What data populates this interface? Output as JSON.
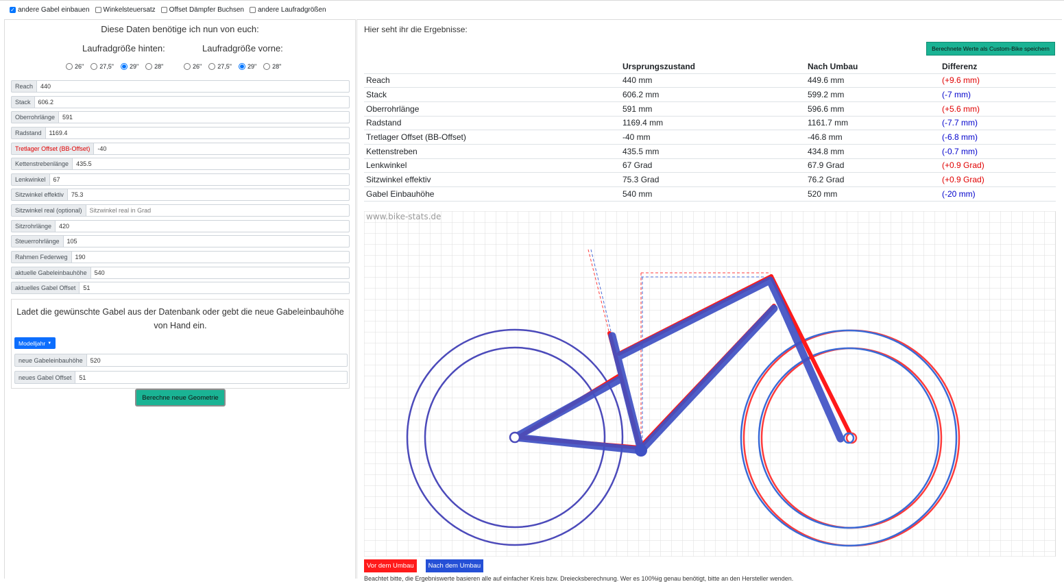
{
  "options": [
    {
      "label": "andere Gabel einbauen",
      "checked": true
    },
    {
      "label": "Winkelsteuersatz",
      "checked": false
    },
    {
      "label": "Offset Dämpfer Buchsen",
      "checked": false
    },
    {
      "label": "andere Laufradgrößen",
      "checked": false
    }
  ],
  "left": {
    "title": "Diese Daten benötige ich nun von euch:",
    "rear_label": "Laufradgröße hinten:",
    "front_label": "Laufradgröße vorne:",
    "rear_sizes": [
      "26\"",
      "27,5\"",
      "29\"",
      "28\""
    ],
    "front_sizes": [
      "26\"",
      "27,5\"",
      "29\"",
      "28\""
    ],
    "rear_selected": "29\"",
    "front_selected": "29\"",
    "fields": [
      {
        "label": "Reach",
        "value": "440"
      },
      {
        "label": "Stack",
        "value": "606.2"
      },
      {
        "label": "Oberrohrlänge",
        "value": "591"
      },
      {
        "label": "Radstand",
        "value": "1169.4"
      },
      {
        "label": "Tretlager Offset (BB-Offset)",
        "value": "-40",
        "highlight": true
      },
      {
        "label": "Kettenstrebenlänge",
        "value": "435.5"
      },
      {
        "label": "Lenkwinkel",
        "value": "67"
      },
      {
        "label": "Sitzwinkel effektiv",
        "value": "75.3"
      },
      {
        "label": "Sitzwinkel real (optional)",
        "value": "",
        "placeholder": "Sitzwinkel real in Grad"
      },
      {
        "label": "Sitzrohrlänge",
        "value": "420"
      },
      {
        "label": "Steuerrohrlänge",
        "value": "105"
      },
      {
        "label": "Rahmen Federweg",
        "value": "190"
      },
      {
        "label": "aktuelle Gabeleinbauhöhe",
        "value": "540"
      },
      {
        "label": "aktuelles Gabel Offset",
        "value": "51"
      }
    ],
    "fork_text": "Ladet die gewünschte Gabel aus der Datenbank oder gebt die neue Gabeleinbauhöhe von Hand ein.",
    "modelljahr_label": "Modelljahr",
    "fork_fields": [
      {
        "label": "neue Gabeleinbauhöhe",
        "value": "520"
      },
      {
        "label": "neues Gabel Offset",
        "value": "51"
      }
    ],
    "calc_button": "Berechne neue Geometrie"
  },
  "right": {
    "title": "Hier seht ihr die Ergebnisse:",
    "save_button": "Berechnete Werte als Custom-Bike speichern",
    "columns": [
      "",
      "Ursprungszustand",
      "Nach Umbau",
      "Differenz"
    ],
    "rows": [
      {
        "name": "Reach",
        "orig": "440 mm",
        "new": "449.6 mm",
        "diff": "(+9.6 mm)",
        "dir": "pos"
      },
      {
        "name": "Stack",
        "orig": "606.2 mm",
        "new": "599.2 mm",
        "diff": "(-7 mm)",
        "dir": "neg"
      },
      {
        "name": "Oberrohrlänge",
        "orig": "591 mm",
        "new": "596.6 mm",
        "diff": "(+5.6 mm)",
        "dir": "pos"
      },
      {
        "name": "Radstand",
        "orig": "1169.4 mm",
        "new": "1161.7 mm",
        "diff": "(-7.7 mm)",
        "dir": "neg"
      },
      {
        "name": "Tretlager Offset (BB-Offset)",
        "orig": "-40 mm",
        "new": "-46.8 mm",
        "diff": "(-6.8 mm)",
        "dir": "neg"
      },
      {
        "name": "Kettenstreben",
        "orig": "435.5 mm",
        "new": "434.8 mm",
        "diff": "(-0.7 mm)",
        "dir": "neg"
      },
      {
        "name": "Lenkwinkel",
        "orig": "67 Grad",
        "new": "67.9 Grad",
        "diff": "(+0.9 Grad)",
        "dir": "pos"
      },
      {
        "name": "Sitzwinkel effektiv",
        "orig": "75.3 Grad",
        "new": "76.2 Grad",
        "diff": "(+0.9 Grad)",
        "dir": "pos"
      },
      {
        "name": "Gabel Einbauhöhe",
        "orig": "540 mm",
        "new": "520 mm",
        "diff": "(-20 mm)",
        "dir": "neg"
      }
    ],
    "watermark": "www.bike-stats.de",
    "legend_before": "Vor dem Umbau",
    "legend_after": "Nach dem Umbau",
    "note": "Beachtet bitte, die Ergebniswerte basieren alle auf einfacher Kreis bzw. Dreiecksberechnung. Wer es 100%ig genau benötigt, bitte an den Hersteller wenden."
  },
  "colors": {
    "before": "#ff1a1a",
    "after": "#3a55c9",
    "accent": "#1ab394",
    "primary": "#0d6efd"
  }
}
